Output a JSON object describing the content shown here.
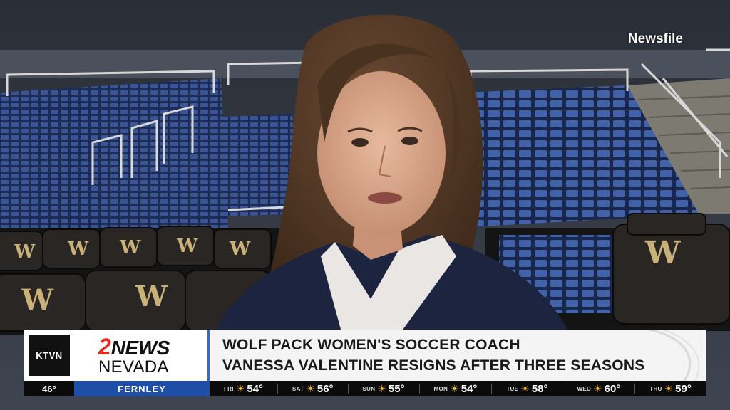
{
  "source_tag": "Newsfile",
  "station": {
    "logo_text": "KTVN"
  },
  "brand": {
    "number": "2",
    "name": "NEWS",
    "region": "NEVADA"
  },
  "headline": {
    "line1": "WOLF PACK WOMEN'S SOCCER COACH",
    "line2": "VANESSA VALENTINE RESIGNS AFTER THREE SEASONS"
  },
  "ticker": {
    "current_temp": "46°",
    "city": "FERNLEY",
    "forecast": [
      {
        "day": "FRI",
        "icon": "partly-sunny-icon",
        "temp": "54°"
      },
      {
        "day": "SAT",
        "icon": "partly-sunny-icon",
        "temp": "56°"
      },
      {
        "day": "SUN",
        "icon": "partly-sunny-icon",
        "temp": "55°"
      },
      {
        "day": "MON",
        "icon": "partly-sunny-icon",
        "temp": "54°"
      },
      {
        "day": "TUE",
        "icon": "partly-sunny-icon",
        "temp": "58°"
      },
      {
        "day": "WED",
        "icon": "partly-sunny-icon",
        "temp": "60°"
      },
      {
        "day": "THU",
        "icon": "sunny-icon",
        "temp": "59°"
      }
    ]
  },
  "colors": {
    "accent_blue": "#1f4ea8",
    "brand_red": "#e8271f",
    "seat_blue": "#2c4478"
  }
}
